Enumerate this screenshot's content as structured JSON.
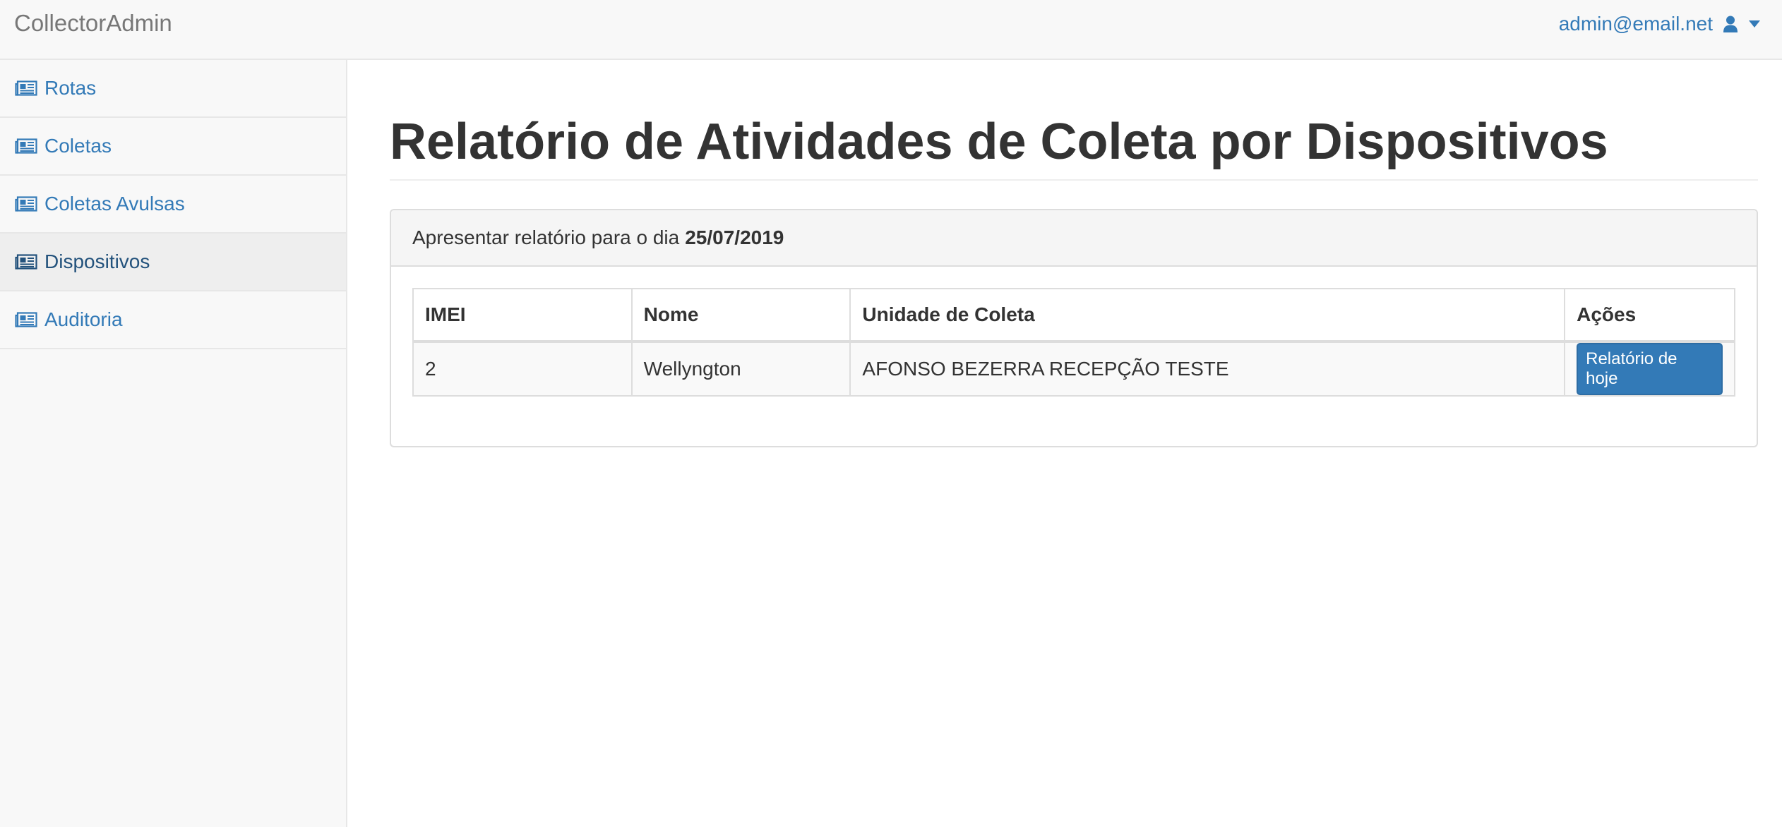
{
  "navbar": {
    "brand": "CollectorAdmin",
    "user_email": "admin@email.net",
    "user_icon": "user-icon",
    "dropdown_icon": "caret-down-icon"
  },
  "sidebar": {
    "item_icon": "newspaper-icon",
    "items": [
      {
        "label": "Rotas",
        "active": false
      },
      {
        "label": "Coletas",
        "active": false
      },
      {
        "label": "Coletas Avulsas",
        "active": false
      },
      {
        "label": "Dispositivos",
        "active": true
      },
      {
        "label": "Auditoria",
        "active": false
      }
    ]
  },
  "main": {
    "title": "Relatório de Atividades de Coleta por Dispositivos",
    "panel": {
      "heading_text": "Apresentar relatório para o dia",
      "heading_date": "25/07/2019"
    },
    "table": {
      "headers": [
        "IMEI",
        "Nome",
        "Unidade de Coleta",
        "Ações"
      ],
      "rows": [
        {
          "imei": "2",
          "nome": "Wellyngton",
          "unidade": "AFONSO BEZERRA RECEPÇÃO TESTE",
          "action_label": "Relatório de hoje"
        }
      ]
    }
  },
  "colors": {
    "link": "#337ab7",
    "link_active": "#23527c",
    "button": "#337ab7",
    "navbar_bg": "#f8f8f8",
    "brand_text": "#777777"
  }
}
